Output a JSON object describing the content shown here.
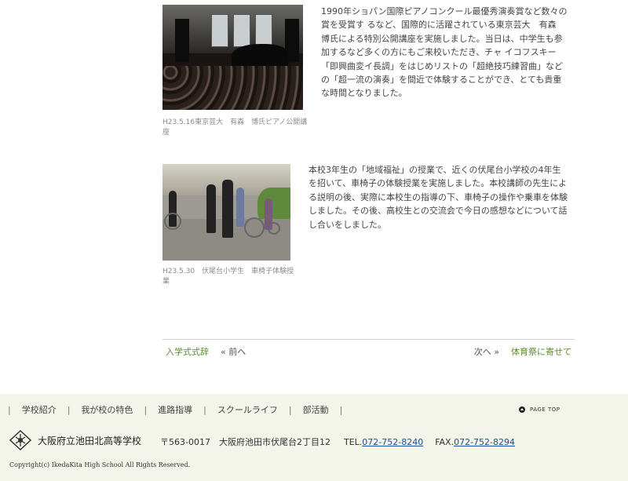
{
  "articles": [
    {
      "caption": "H23.5.16東京芸大　有森　博氏ピアノ公開講座",
      "lines": [
        "1990年ショパン国際ピアノコンクール最優秀演奏賞など数々の",
        "賞を受賞す るなど、国際的に活躍されている東京芸大　有森",
        "博氏による特別公開講座を実施しました。当日は、中学生も参",
        "加するなど多くの方にもご来校いただき、チャ イコフスキー",
        "「即興曲変イ長調」をはじめリストの「超絶技巧練習曲」など",
        "の「超一流の演奏」を間近で体験することができ、とても貴重",
        "な時間となりました。"
      ]
    },
    {
      "caption": "H23.5.30　伏尾台小学生　車椅子体験授業",
      "lines": [
        "本校3年生の「地域福祉」の授業で、近くの伏尾台小学校の4年生",
        "を招いて、車椅子の体験授業を実施しました。本校講師の先生によ",
        "る説明の後、実際に本校生の指導の下、車椅子の操作や乗車を体験",
        "しました。その後、高校生との交流会で今日の感想などについて話",
        "し合いをしました。"
      ]
    }
  ],
  "pager": {
    "prev_title": "入学式式辞",
    "prev_label": "« 前へ",
    "next_label": "次へ »",
    "next_title": "体育祭に寄せて"
  },
  "footer": {
    "nav": [
      "学校紹介",
      "我が校の特色",
      "進路指導",
      "スクールライフ",
      "部活動"
    ],
    "page_top": "PAGE TOP",
    "school_name": "大阪府立池田北高等学校",
    "address": "〒563-0017　大阪府池田市伏尾台2丁目12",
    "tel_label": "TEL.",
    "tel": "072-752-8240",
    "fax_label": "FAX.",
    "fax": "072-752-8294",
    "copyright": "Copyright(c) IkedaKita High School All Rights Reserved."
  },
  "colors": {
    "link_green": "#5a8a2a",
    "phone_blue": "#1a4f9c",
    "footer_bg": "#f3f4ea"
  }
}
